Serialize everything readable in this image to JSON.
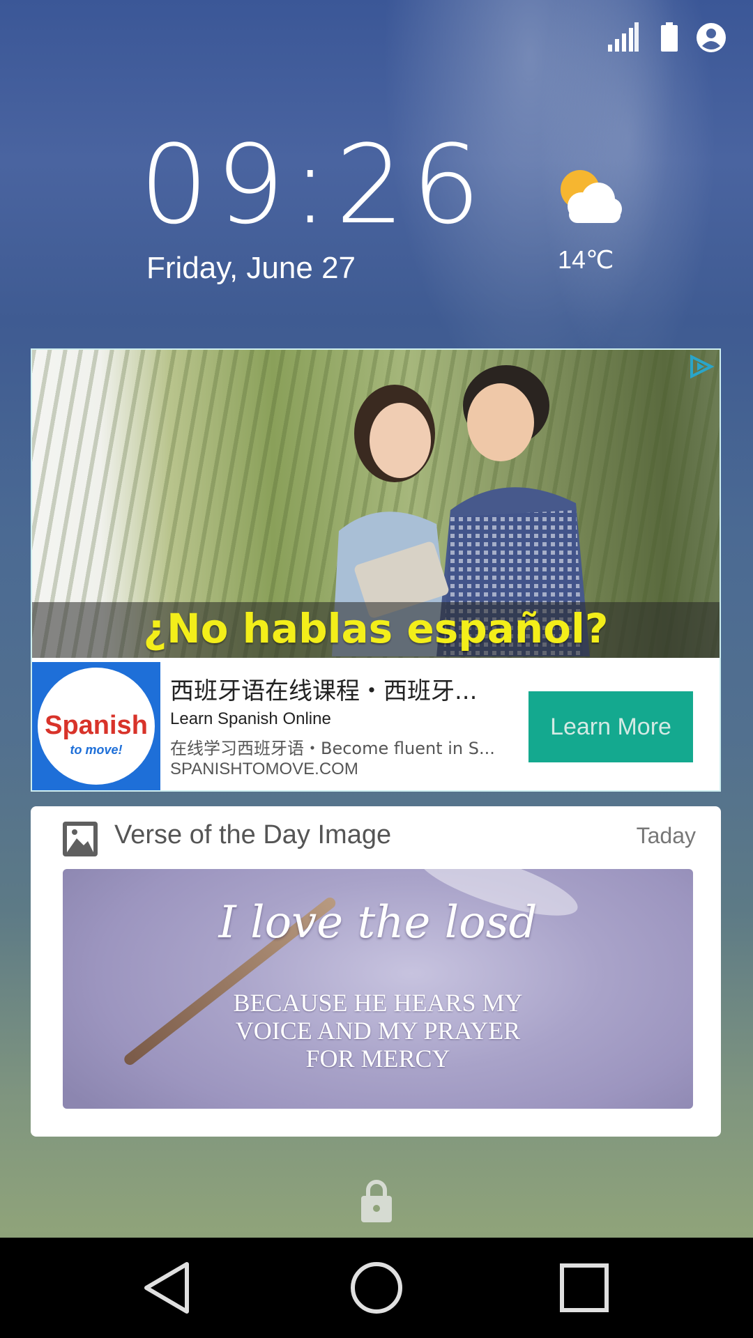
{
  "clock": {
    "time": "09:26",
    "date": "Friday, June 27"
  },
  "weather": {
    "temperature": "14℃",
    "icon": "partly-cloudy-icon"
  },
  "status_bar": {
    "icons": [
      "signal-icon",
      "battery-icon",
      "account-icon"
    ]
  },
  "ad": {
    "headline": "¿No hablas español?",
    "logo_word": "Spanish",
    "logo_tagline": "to move!",
    "title": "西班牙语在线课程・西班牙...",
    "subtitle": "Learn Spanish Online",
    "description": "在线学习西班牙语・Become fluent in S...",
    "url": "SPANISHTOMOVE.COM",
    "cta_label": "Learn More",
    "cta_color": "#14a98f",
    "headline_color": "#f3ee1a"
  },
  "verse_card": {
    "title": "Verse of the Day Image",
    "timestamp": "Taday",
    "image_script_text": "I love the losd",
    "image_body_text": "BECAUSE HE HEARS MY VOICE AND MY PRAYER FOR MERCY",
    "image_body_lines": [
      "BECAUSE HE HEARS MY",
      "VOICE AND MY PRAYER",
      "FOR MERCY"
    ]
  },
  "navigation": {
    "buttons": [
      "back-icon",
      "home-icon",
      "recents-icon"
    ]
  }
}
